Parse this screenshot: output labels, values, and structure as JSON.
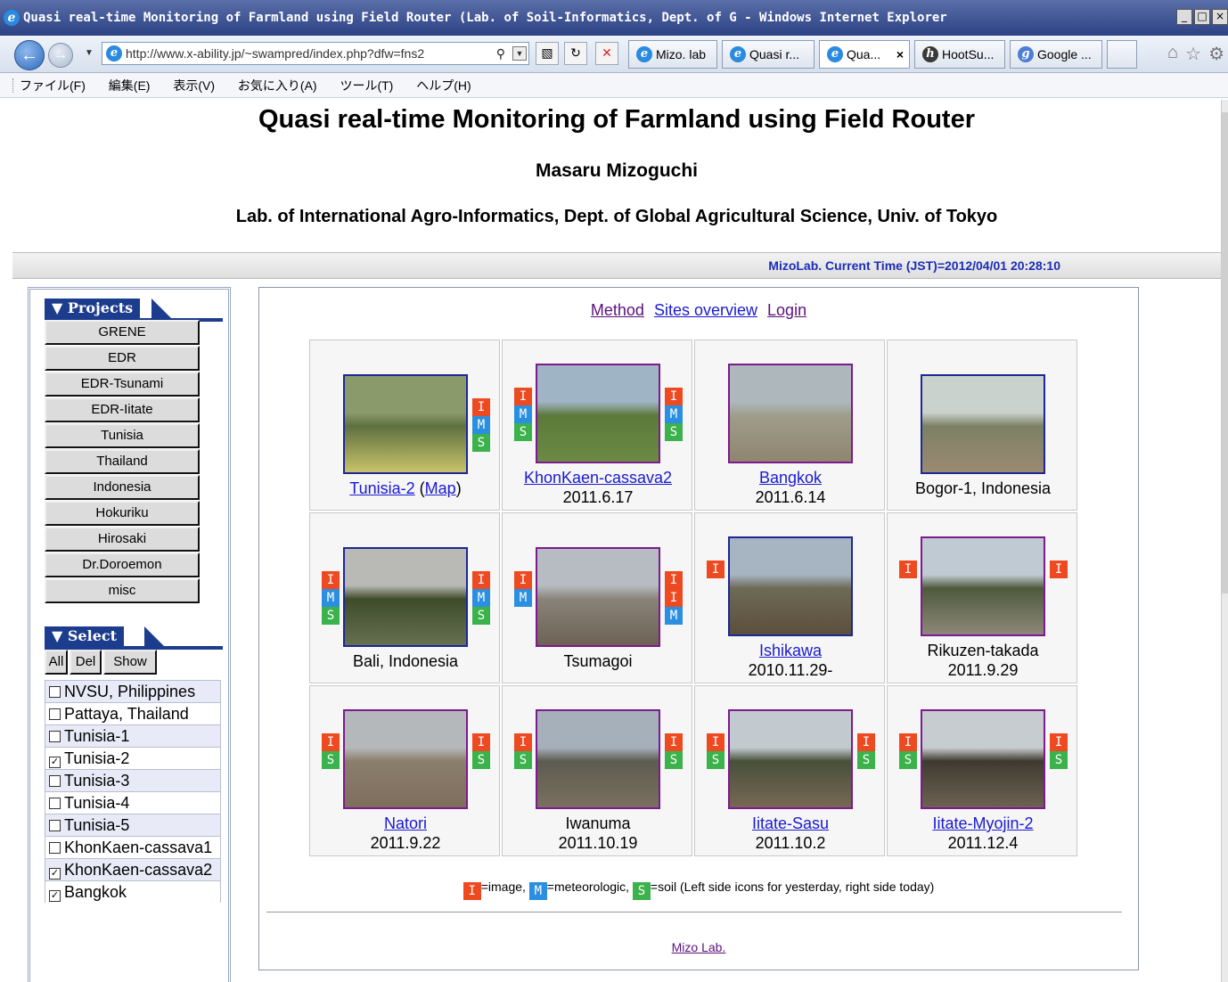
{
  "window": {
    "title": "Quasi real-time Monitoring of Farmland using Field Router (Lab. of Soil-Informatics, Dept. of G - Windows Internet Explorer"
  },
  "browser": {
    "address": "http://www.x-ability.jp/~swampred/index.php?dfw=fns2",
    "tabs": [
      {
        "label": "Mizo. lab"
      },
      {
        "label": "Quasi r..."
      },
      {
        "label": "Qua..."
      },
      {
        "label": "HootSu..."
      },
      {
        "label": "Google ..."
      }
    ],
    "menu": [
      "ファイル(F)",
      "編集(E)",
      "表示(V)",
      "お気に入り(A)",
      "ツール(T)",
      "ヘルプ(H)"
    ]
  },
  "header": {
    "title": "Quasi real-time Monitoring of Farmland using Field Router",
    "author": "Masaru Mizoguchi",
    "affiliation": "Lab. of International Agro-Informatics, Dept. of Global Agricultural Science, Univ. of Tokyo",
    "current_time": "MizoLab. Current Time (JST)=2012/04/01 20:28:10"
  },
  "sidebar": {
    "projects_title": "▼ Projects",
    "projects": [
      "GRENE",
      "EDR",
      "EDR-Tsunami",
      "EDR-Iitate",
      "Tunisia",
      "Thailand",
      "Indonesia",
      "Hokuriku",
      "Hirosaki",
      "Dr.Doroemon",
      "misc"
    ],
    "select_title": "▼ Select",
    "select_buttons": [
      "All",
      "Del",
      "Show"
    ],
    "sites": [
      {
        "label": "NVSU, Philippines",
        "checked": false
      },
      {
        "label": "Pattaya, Thailand",
        "checked": false
      },
      {
        "label": "Tunisia-1",
        "checked": false
      },
      {
        "label": "Tunisia-2",
        "checked": true
      },
      {
        "label": "Tunisia-3",
        "checked": false
      },
      {
        "label": "Tunisia-4",
        "checked": false
      },
      {
        "label": "Tunisia-5",
        "checked": false
      },
      {
        "label": "KhonKaen-cassava1",
        "checked": false
      },
      {
        "label": "KhonKaen-cassava2",
        "checked": true
      },
      {
        "label": "Bangkok",
        "checked": true
      }
    ]
  },
  "main": {
    "links": [
      "Method",
      "Sites overview",
      "Login"
    ],
    "cells": [
      {
        "name": "Tunisia-2",
        "extra": "Map",
        "date": "",
        "linked": true,
        "frame": "blue",
        "colors": [
          "#8b9a6a",
          "#5f7040",
          "#c9c36a"
        ],
        "left": [],
        "right": [
          "I",
          "M",
          "S"
        ]
      },
      {
        "name": "KhonKaen-cassava2",
        "date": "2011.6.17",
        "linked": true,
        "frame": "purple",
        "colors": [
          "#9fb4c4",
          "#5b7a3a",
          "#6c8a45"
        ],
        "left": [
          "I",
          "M",
          "S"
        ],
        "right": [
          "I",
          "M",
          "S"
        ]
      },
      {
        "name": "Bangkok",
        "date": "2011.6.14",
        "linked": true,
        "frame": "purple",
        "colors": [
          "#aeb7bb",
          "#9e9e8a",
          "#8f8570"
        ],
        "left": [],
        "right": []
      },
      {
        "name": "Bogor-1, Indonesia",
        "date": "",
        "linked": false,
        "frame": "blue",
        "colors": [
          "#c9d2cc",
          "#7c8064",
          "#9b8a72"
        ],
        "left": [],
        "right": []
      },
      {
        "name": "Bali, Indonesia",
        "date": "",
        "linked": false,
        "frame": "blue",
        "colors": [
          "#b9b9b5",
          "#3e4c2a",
          "#657050"
        ],
        "left": [
          "I",
          "M",
          "S"
        ],
        "right": [
          "I",
          "M",
          "S"
        ]
      },
      {
        "name": "Tsumagoi",
        "date": "",
        "linked": false,
        "frame": "purple",
        "colors": [
          "#b7bcc2",
          "#8a8379",
          "#6d6255"
        ],
        "left": [
          "I",
          "M"
        ],
        "right": [
          "I",
          "I",
          "M"
        ]
      },
      {
        "name": "Ishikawa",
        "date": "2010.11.29-",
        "linked": true,
        "frame": "blue",
        "colors": [
          "#a7b4c2",
          "#6d6a55",
          "#5c4f3d"
        ],
        "left": [
          "I"
        ],
        "right": []
      },
      {
        "name": "Rikuzen-takada",
        "date": "2011.9.29",
        "linked": false,
        "frame": "purple",
        "colors": [
          "#c0cad3",
          "#4e5a3c",
          "#8d877a"
        ],
        "left": [
          "I"
        ],
        "right": [
          "I"
        ]
      },
      {
        "name": "Natori",
        "date": "2011.9.22",
        "linked": true,
        "frame": "purple",
        "colors": [
          "#b5b8ba",
          "#8c7e6c",
          "#7d6f5c"
        ],
        "left": [
          "I",
          "S"
        ],
        "right": [
          "I",
          "S"
        ]
      },
      {
        "name": "Iwanuma",
        "date": "2011.10.19",
        "linked": false,
        "frame": "purple",
        "colors": [
          "#a6b0bb",
          "#5d5c50",
          "#7a7060"
        ],
        "left": [
          "I",
          "S"
        ],
        "right": [
          "I",
          "S"
        ]
      },
      {
        "name": "Iitate-Sasu",
        "date": "2011.10.2",
        "linked": true,
        "frame": "purple",
        "colors": [
          "#c2cad0",
          "#48503a",
          "#776854"
        ],
        "left": [
          "I",
          "S"
        ],
        "right": [
          "I",
          "S"
        ]
      },
      {
        "name": "Iitate-Myojin-2",
        "date": "2011.12.4",
        "linked": true,
        "frame": "purple",
        "colors": [
          "#c7ccd0",
          "#3f3a30",
          "#6c6252"
        ],
        "left": [
          "I",
          "S"
        ],
        "right": [
          "I",
          "S"
        ]
      }
    ],
    "legend": {
      "image": "=image,",
      "meteo": "=meteorologic,",
      "soil": "=soil (Left side icons for yesterday, right side today)"
    },
    "footer_link": "Mizo Lab."
  }
}
